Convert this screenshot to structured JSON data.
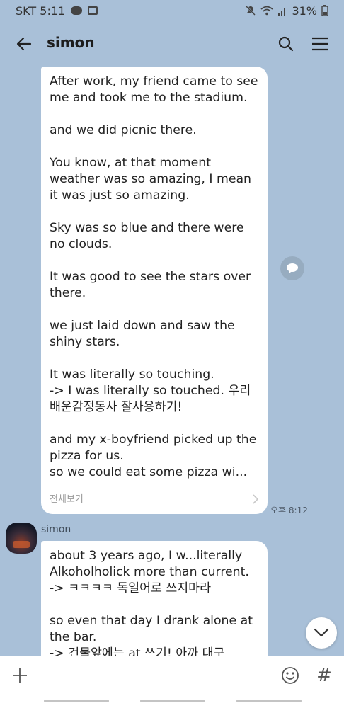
{
  "status_bar": {
    "carrier_time": "SKT 5:11",
    "battery": "31%",
    "icons": [
      "talk-badge-icon",
      "image-icon",
      "mute-icon",
      "wifi-icon",
      "signal-icon",
      "battery-icon"
    ]
  },
  "header": {
    "title": "simon",
    "icons": [
      "back-arrow-icon",
      "search-icon",
      "menu-icon"
    ]
  },
  "messages": [
    {
      "paragraphs": [
        "After work, my friend came to see me and took me to the stadium.",
        "and we did picnic there.",
        "You know, at that moment weather was so amazing, I mean it was just so amazing.",
        "Sky was so blue and there were no clouds.",
        "It was good to see the stars over there.",
        "we just laid down and saw the shiny stars.",
        "It was literally so touching.\n-> I was literally so touched. 우리 배운감정동사 잘사용하기!",
        "and my x-boyfriend picked up the pizza for us.\nso we could eat some pizza wi..."
      ],
      "see_more": "전체보기",
      "time": "오후 8:12"
    },
    {
      "sender": "simon",
      "paragraphs": [
        "about 3 years ago, I w...literally Alkoholholick more than current.\n-> ㅋㅋㅋㅋ 독일어로 쓰지마라",
        "so even that day I drank alone at the bar.\n-> 건물앞에는 at 쓰기! 아까 대구"
      ]
    }
  ],
  "input_bar": {
    "icons": [
      "plus-icon",
      "emoji-icon",
      "hashtag-icon"
    ],
    "hash_glyph": "#"
  },
  "colors": {
    "background": "#a9c0d8",
    "bubble": "#ffffff"
  }
}
